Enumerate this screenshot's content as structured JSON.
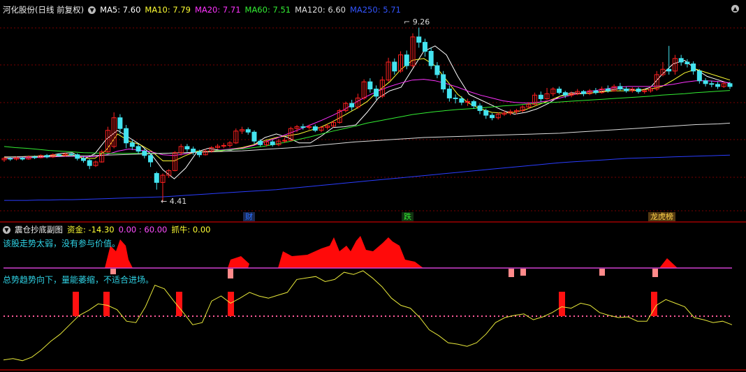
{
  "header": {
    "title": "河化股份(日线 前复权)",
    "ma": [
      {
        "label": "MA5: 7.60",
        "color": "#ffffff"
      },
      {
        "label": "MA10: 7.79",
        "color": "#ffff33"
      },
      {
        "label": "MA20: 7.71",
        "color": "#ff33ff"
      },
      {
        "label": "MA60: 7.51",
        "color": "#33ee33"
      },
      {
        "label": "MA120: 6.60",
        "color": "#dddddd"
      },
      {
        "label": "MA250: 5.71",
        "color": "#3355ff"
      }
    ]
  },
  "annotations": {
    "high": "9.26",
    "low": "4.41"
  },
  "events": [
    {
      "text": "财",
      "color": "#2a6fff",
      "bg": "#1a2a55"
    },
    {
      "text": "跌",
      "color": "#33ee33",
      "bg": "#113311"
    },
    {
      "text": "龙虎榜",
      "color": "#ffd24a",
      "bg": "#553a11"
    }
  ],
  "indicator": {
    "title": "震仓抄底副图",
    "fund_label": "资金: -14.30",
    "values": "0.00 : 60.00",
    "grab_label": "抓牛: 0.00",
    "note1": "该股走势太弱，没有参与价值。",
    "note2": "总势趋势向下，量能萎缩，不适合进场。"
  },
  "colors": {
    "up": "#ff2020",
    "down": "#44e4f0",
    "grid": "#7a0000",
    "panel_line": "#d6d6d6"
  },
  "chart_data": {
    "type": "candlestick",
    "ylim": [
      4.2,
      9.6
    ],
    "high": 9.26,
    "low": 4.41,
    "candles": [
      [
        5.58,
        5.62,
        5.66,
        5.52
      ],
      [
        5.62,
        5.6,
        5.66,
        5.55
      ],
      [
        5.6,
        5.63,
        5.67,
        5.56
      ],
      [
        5.63,
        5.6,
        5.66,
        5.56
      ],
      [
        5.6,
        5.66,
        5.7,
        5.58
      ],
      [
        5.66,
        5.64,
        5.7,
        5.6
      ],
      [
        5.64,
        5.7,
        5.73,
        5.62
      ],
      [
        5.7,
        5.66,
        5.74,
        5.62
      ],
      [
        5.66,
        5.72,
        5.76,
        5.63
      ],
      [
        5.72,
        5.7,
        5.76,
        5.66
      ],
      [
        5.7,
        5.74,
        5.78,
        5.67
      ],
      [
        5.74,
        5.72,
        5.78,
        5.68
      ],
      [
        5.72,
        5.62,
        5.76,
        5.56
      ],
      [
        5.62,
        5.56,
        5.68,
        5.5
      ],
      [
        5.56,
        5.42,
        5.6,
        5.32
      ],
      [
        5.42,
        5.52,
        5.56,
        5.38
      ],
      [
        5.52,
        5.8,
        5.86,
        5.5
      ],
      [
        5.8,
        6.4,
        6.5,
        5.78
      ],
      [
        5.95,
        6.75,
        6.9,
        5.9
      ],
      [
        6.75,
        6.45,
        6.85,
        6.3
      ],
      [
        6.45,
        6.05,
        6.55,
        5.9
      ],
      [
        6.05,
        5.95,
        6.15,
        5.85
      ],
      [
        5.95,
        5.82,
        6.02,
        5.75
      ],
      [
        5.82,
        5.7,
        5.88,
        5.62
      ],
      [
        5.7,
        5.52,
        5.75,
        5.38
      ],
      [
        5.2,
        4.95,
        5.25,
        4.75
      ],
      [
        4.95,
        5.15,
        5.2,
        4.41
      ],
      [
        5.15,
        5.28,
        5.32,
        5.08
      ],
      [
        5.28,
        5.78,
        5.82,
        5.26
      ],
      [
        5.78,
        5.95,
        6.02,
        5.7
      ],
      [
        5.95,
        5.88,
        6.02,
        5.8
      ],
      [
        5.88,
        5.8,
        5.95,
        5.72
      ],
      [
        5.8,
        5.72,
        5.86,
        5.65
      ],
      [
        5.72,
        5.82,
        5.88,
        5.7
      ],
      [
        5.82,
        5.92,
        5.96,
        5.78
      ],
      [
        5.92,
        5.96,
        6.02,
        5.88
      ],
      [
        5.96,
        5.98,
        6.05,
        5.9
      ],
      [
        5.98,
        6.05,
        6.1,
        5.92
      ],
      [
        6.05,
        6.38,
        6.45,
        6.02
      ],
      [
        6.38,
        6.42,
        6.5,
        6.3
      ],
      [
        6.42,
        6.35,
        6.48,
        6.28
      ],
      [
        6.35,
        6.1,
        6.4,
        6.02
      ],
      [
        6.1,
        6.0,
        6.15,
        5.95
      ],
      [
        6.0,
        6.08,
        6.12,
        5.95
      ],
      [
        6.08,
        6.0,
        6.14,
        5.95
      ],
      [
        6.0,
        6.1,
        6.16,
        5.96
      ],
      [
        6.1,
        6.12,
        6.2,
        6.05
      ],
      [
        6.12,
        6.45,
        6.5,
        6.1
      ],
      [
        6.45,
        6.5,
        6.55,
        6.35
      ],
      [
        6.5,
        6.48,
        6.58,
        6.42
      ],
      [
        6.48,
        6.5,
        6.56,
        6.42
      ],
      [
        6.5,
        6.4,
        6.56,
        6.35
      ],
      [
        6.4,
        6.48,
        6.52,
        6.35
      ],
      [
        6.48,
        6.52,
        6.58,
        6.42
      ],
      [
        6.52,
        6.62,
        6.68,
        6.48
      ],
      [
        6.62,
        6.95,
        7.0,
        6.58
      ],
      [
        6.95,
        7.15,
        7.2,
        6.9
      ],
      [
        7.15,
        7.05,
        7.25,
        6.95
      ],
      [
        7.05,
        7.3,
        7.42,
        7.0
      ],
      [
        7.3,
        7.75,
        7.82,
        7.25
      ],
      [
        7.75,
        7.55,
        7.85,
        7.45
      ],
      [
        7.55,
        7.35,
        7.65,
        7.25
      ],
      [
        7.35,
        7.8,
        7.9,
        7.3
      ],
      [
        7.8,
        8.3,
        8.42,
        7.75
      ],
      [
        8.3,
        8.05,
        8.4,
        7.95
      ],
      [
        8.05,
        8.5,
        8.6,
        8.0
      ],
      [
        8.5,
        8.2,
        8.62,
        8.1
      ],
      [
        8.2,
        9.0,
        9.1,
        8.15
      ],
      [
        9.0,
        8.85,
        9.26,
        8.7
      ],
      [
        8.85,
        8.6,
        8.95,
        8.45
      ],
      [
        8.6,
        8.2,
        8.7,
        8.1
      ],
      [
        8.2,
        7.95,
        8.3,
        7.85
      ],
      [
        7.95,
        7.55,
        8.05,
        7.45
      ],
      [
        7.55,
        7.3,
        7.65,
        7.2
      ],
      [
        7.3,
        7.28,
        7.4,
        7.15
      ],
      [
        7.28,
        7.18,
        7.35,
        7.1
      ],
      [
        7.18,
        7.2,
        7.28,
        7.08
      ],
      [
        7.2,
        7.08,
        7.25,
        7.0
      ],
      [
        7.08,
        6.95,
        7.15,
        6.85
      ],
      [
        6.95,
        6.82,
        7.0,
        6.72
      ],
      [
        6.82,
        6.75,
        6.88,
        6.68
      ],
      [
        6.75,
        6.85,
        6.9,
        6.7
      ],
      [
        6.85,
        6.88,
        6.95,
        6.8
      ],
      [
        6.88,
        6.92,
        6.98,
        6.82
      ],
      [
        6.92,
        6.95,
        7.0,
        6.85
      ],
      [
        6.95,
        7.05,
        7.1,
        6.9
      ],
      [
        7.05,
        7.12,
        7.18,
        7.0
      ],
      [
        7.12,
        7.38,
        7.45,
        7.1
      ],
      [
        7.38,
        7.28,
        7.48,
        7.2
      ],
      [
        7.28,
        7.42,
        7.58,
        7.25
      ],
      [
        7.42,
        7.55,
        7.6,
        7.35
      ],
      [
        7.55,
        7.45,
        7.62,
        7.4
      ],
      [
        7.45,
        7.38,
        7.5,
        7.3
      ],
      [
        7.38,
        7.42,
        7.48,
        7.32
      ],
      [
        7.42,
        7.48,
        7.55,
        7.38
      ],
      [
        7.48,
        7.42,
        7.52,
        7.35
      ],
      [
        7.42,
        7.5,
        7.55,
        7.38
      ],
      [
        7.5,
        7.45,
        7.58,
        7.4
      ],
      [
        7.45,
        7.55,
        7.62,
        7.42
      ],
      [
        7.55,
        7.5,
        7.65,
        7.45
      ],
      [
        7.5,
        7.62,
        7.68,
        7.48
      ],
      [
        7.62,
        7.55,
        7.72,
        7.5
      ],
      [
        7.55,
        7.5,
        7.62,
        7.45
      ],
      [
        7.5,
        7.55,
        7.6,
        7.45
      ],
      [
        7.55,
        7.48,
        7.6,
        7.42
      ],
      [
        7.48,
        7.5,
        7.55,
        7.42
      ],
      [
        7.5,
        7.55,
        7.62,
        7.45
      ],
      [
        7.55,
        7.95,
        8.05,
        7.5
      ],
      [
        7.95,
        8.1,
        8.3,
        7.9
      ],
      [
        8.1,
        8.05,
        8.75,
        7.95
      ],
      [
        8.05,
        8.4,
        8.5,
        7.95
      ],
      [
        8.4,
        8.3,
        8.5,
        8.2
      ],
      [
        8.3,
        8.25,
        8.38,
        8.15
      ],
      [
        8.25,
        8.05,
        8.32,
        7.95
      ],
      [
        8.05,
        7.78,
        8.1,
        7.7
      ],
      [
        7.78,
        7.7,
        7.85,
        7.62
      ],
      [
        7.7,
        7.68,
        7.78,
        7.6
      ],
      [
        7.68,
        7.62,
        7.75,
        7.55
      ],
      [
        7.62,
        7.7,
        7.75,
        7.58
      ],
      [
        7.7,
        7.62,
        7.75,
        7.55
      ]
    ],
    "ma_series": [
      {
        "name": "MA5",
        "color": "#ffffff",
        "values": [
          5.62,
          5.63,
          5.64,
          5.65,
          5.7,
          5.76,
          5.78,
          5.6,
          5.75,
          6.15,
          6.4,
          6.2,
          6.0,
          5.72,
          5.3,
          5.05,
          5.35,
          5.8,
          5.9,
          5.85,
          5.85,
          5.92,
          5.99,
          6.2,
          6.3,
          6.2,
          6.05,
          6.05,
          6.25,
          6.48,
          6.5,
          6.55,
          6.9,
          7.3,
          7.5,
          7.6,
          8.1,
          8.6,
          8.75,
          8.5,
          7.9,
          7.4,
          7.25,
          7.1,
          6.95,
          6.85,
          6.9,
          7.0,
          7.15,
          7.35,
          7.45,
          7.42,
          7.45,
          7.5,
          7.55,
          7.55,
          7.5,
          7.6,
          7.95,
          8.25,
          8.35,
          8.1,
          7.9,
          7.8,
          7.7
        ]
      },
      {
        "name": "MA10",
        "color": "#ffff33",
        "values": [
          5.65,
          5.66,
          5.67,
          5.68,
          5.69,
          5.7,
          5.72,
          5.62,
          5.62,
          5.85,
          6.3,
          6.1,
          6.0,
          5.82,
          5.55,
          5.55,
          5.7,
          5.82,
          5.8,
          5.82,
          5.88,
          5.92,
          6.0,
          6.12,
          6.2,
          6.25,
          6.3,
          6.4,
          6.5,
          6.65,
          6.82,
          7.0,
          7.2,
          7.5,
          7.75,
          8.1,
          8.35,
          8.4,
          8.2,
          7.8,
          7.4,
          7.15,
          7.0,
          6.9,
          6.88,
          6.9,
          6.98,
          7.1,
          7.22,
          7.35,
          7.4,
          7.42,
          7.45,
          7.48,
          7.5,
          7.5,
          7.52,
          7.55,
          7.62,
          7.8,
          8.0,
          8.1,
          8.0,
          7.9,
          7.8
        ]
      },
      {
        "name": "MA20",
        "color": "#ff33ff",
        "values": [
          5.62,
          5.63,
          5.64,
          5.65,
          5.66,
          5.67,
          5.68,
          5.66,
          5.67,
          5.72,
          5.82,
          5.88,
          5.85,
          5.8,
          5.72,
          5.7,
          5.75,
          5.8,
          5.82,
          5.85,
          5.88,
          5.9,
          5.98,
          6.08,
          6.18,
          6.3,
          6.42,
          6.55,
          6.68,
          6.82,
          6.98,
          7.18,
          7.35,
          7.5,
          7.62,
          7.72,
          7.8,
          7.82,
          7.78,
          7.7,
          7.6,
          7.48,
          7.38,
          7.3,
          7.22,
          7.18,
          7.16,
          7.18,
          7.22,
          7.3,
          7.38,
          7.45,
          7.5,
          7.55,
          7.6,
          7.62,
          7.62,
          7.62,
          7.64,
          7.68,
          7.74,
          7.78,
          7.78,
          7.76,
          7.72
        ]
      },
      {
        "name": "MA60",
        "color": "#33ee33",
        "values": [
          5.95,
          5.92,
          5.9,
          5.87,
          5.84,
          5.82,
          5.8,
          5.78,
          5.77,
          5.76,
          5.76,
          5.76,
          5.76,
          5.76,
          5.76,
          5.77,
          5.78,
          5.8,
          5.82,
          5.84,
          5.86,
          5.88,
          5.92,
          5.96,
          6.02,
          6.08,
          6.15,
          6.22,
          6.3,
          6.38,
          6.45,
          6.52,
          6.6,
          6.66,
          6.72,
          6.78,
          6.84,
          6.88,
          6.92,
          6.95,
          6.98,
          7.0,
          7.02,
          7.05,
          7.08,
          7.1,
          7.13,
          7.15,
          7.17,
          7.19,
          7.21,
          7.23,
          7.25,
          7.27,
          7.29,
          7.31,
          7.33,
          7.35,
          7.38,
          7.4,
          7.42,
          7.45,
          7.47,
          7.49,
          7.51
        ]
      },
      {
        "name": "MA120",
        "color": "#dddddd",
        "values": [
          5.66,
          5.66,
          5.67,
          5.67,
          5.68,
          5.68,
          5.69,
          5.69,
          5.7,
          5.71,
          5.72,
          5.73,
          5.74,
          5.75,
          5.76,
          5.77,
          5.78,
          5.79,
          5.8,
          5.81,
          5.82,
          5.83,
          5.85,
          5.87,
          5.89,
          5.91,
          5.93,
          5.96,
          5.99,
          6.02,
          6.05,
          6.08,
          6.1,
          6.12,
          6.14,
          6.16,
          6.18,
          6.2,
          6.21,
          6.22,
          6.23,
          6.24,
          6.25,
          6.26,
          6.27,
          6.28,
          6.29,
          6.3,
          6.31,
          6.32,
          6.34,
          6.36,
          6.38,
          6.4,
          6.42,
          6.44,
          6.46,
          6.48,
          6.5,
          6.52,
          6.54,
          6.56,
          6.57,
          6.58,
          6.6
        ]
      },
      {
        "name": "MA250",
        "color": "#2a3dff",
        "values": [
          4.45,
          4.45,
          4.45,
          4.46,
          4.46,
          4.47,
          4.47,
          4.48,
          4.49,
          4.5,
          4.51,
          4.52,
          4.53,
          4.54,
          4.55,
          4.57,
          4.59,
          4.61,
          4.63,
          4.65,
          4.67,
          4.69,
          4.71,
          4.73,
          4.75,
          4.78,
          4.81,
          4.84,
          4.87,
          4.9,
          4.93,
          4.96,
          4.99,
          5.02,
          5.05,
          5.08,
          5.11,
          5.14,
          5.17,
          5.2,
          5.23,
          5.26,
          5.29,
          5.32,
          5.35,
          5.38,
          5.41,
          5.44,
          5.47,
          5.5,
          5.52,
          5.54,
          5.56,
          5.58,
          5.6,
          5.62,
          5.63,
          5.64,
          5.65,
          5.66,
          5.67,
          5.68,
          5.69,
          5.7,
          5.71
        ]
      }
    ],
    "indicator_line": [
      6,
      8,
      5,
      10,
      20,
      32,
      42,
      55,
      68,
      75,
      84,
      82,
      76,
      60,
      58,
      80,
      110,
      105,
      88,
      72,
      55,
      58,
      88,
      95,
      85,
      92,
      100,
      95,
      92,
      96,
      100,
      118,
      120,
      122,
      115,
      118,
      128,
      125,
      130,
      120,
      108,
      92,
      82,
      78,
      65,
      48,
      40,
      30,
      28,
      25,
      30,
      42,
      58,
      65,
      68,
      70,
      62,
      66,
      72,
      80,
      78,
      85,
      82,
      72,
      68,
      65,
      66,
      60,
      60,
      82,
      90,
      85,
      80,
      65,
      62,
      58,
      60,
      55
    ]
  }
}
